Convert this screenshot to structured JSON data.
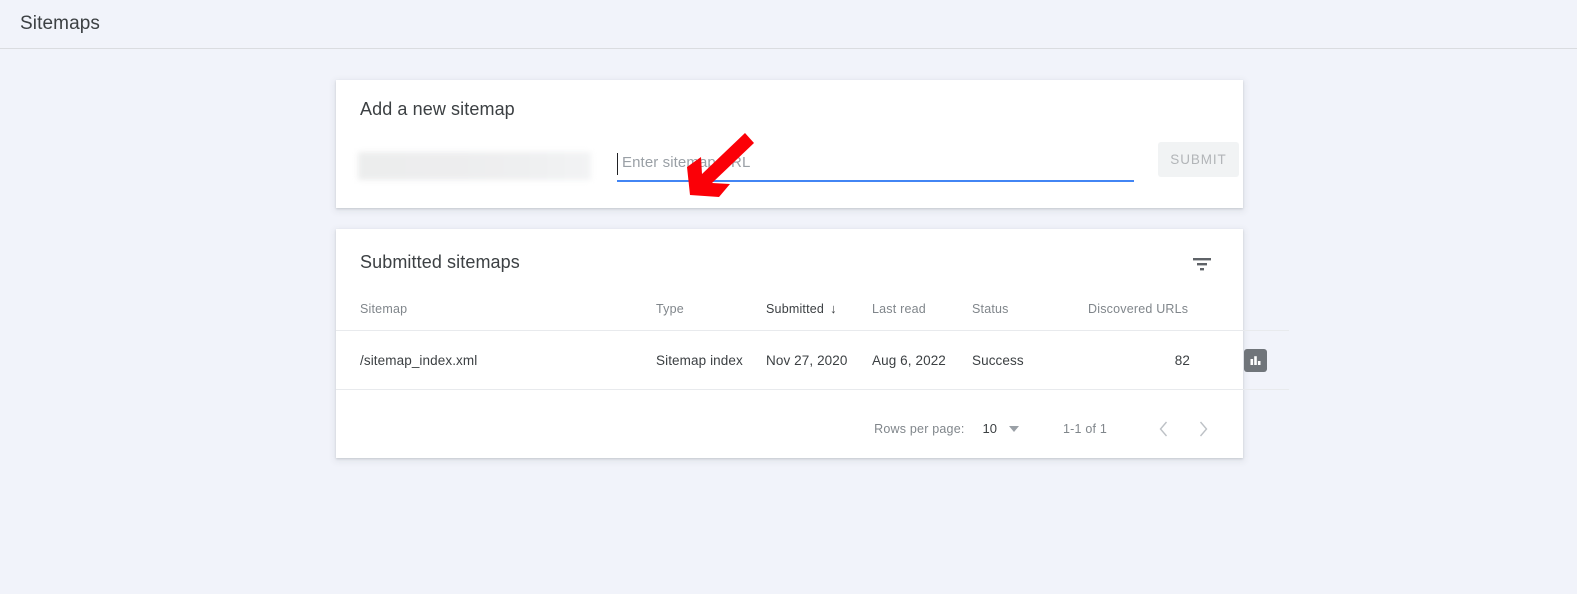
{
  "header": {
    "title": "Sitemaps"
  },
  "add_sitemap": {
    "title": "Add a new sitemap",
    "domain_prefix_redacted": "",
    "url_input_placeholder": "Enter sitemap URL",
    "url_input_value": "",
    "submit_label": "SUBMIT",
    "submit_disabled": true,
    "focus_underline_color": "#4285f4"
  },
  "annotation": {
    "arrow_color": "#fb0007",
    "arrow_direction": "down-left",
    "points_to": "url-input"
  },
  "submitted_sitemaps": {
    "title": "Submitted sitemaps",
    "filter_icon": "filter-list-icon",
    "columns": [
      {
        "label": "Sitemap",
        "key": "sitemap"
      },
      {
        "label": "Type",
        "key": "type"
      },
      {
        "label": "Submitted",
        "key": "submitted",
        "sorted": true,
        "sort_direction": "desc",
        "sort_glyph": "↓"
      },
      {
        "label": "Last read",
        "key": "last_read"
      },
      {
        "label": "Status",
        "key": "status"
      },
      {
        "label": "Discovered URLs",
        "key": "discovered_urls"
      }
    ],
    "rows": [
      {
        "sitemap": "/sitemap_index.xml",
        "type": "Sitemap index",
        "submitted": "Nov 27, 2020",
        "last_read": "Aug 6, 2022",
        "status": "Success",
        "status_color": "#1e8e3e",
        "discovered_urls": "82",
        "action_icon": "bar-chart-icon"
      }
    ],
    "pagination": {
      "rows_per_page_label": "Rows per page:",
      "rows_per_page_value": "10",
      "range_text": "1-1 of 1",
      "prev_label": "‹",
      "next_label": "›",
      "prev_disabled": true,
      "next_disabled": true
    }
  }
}
